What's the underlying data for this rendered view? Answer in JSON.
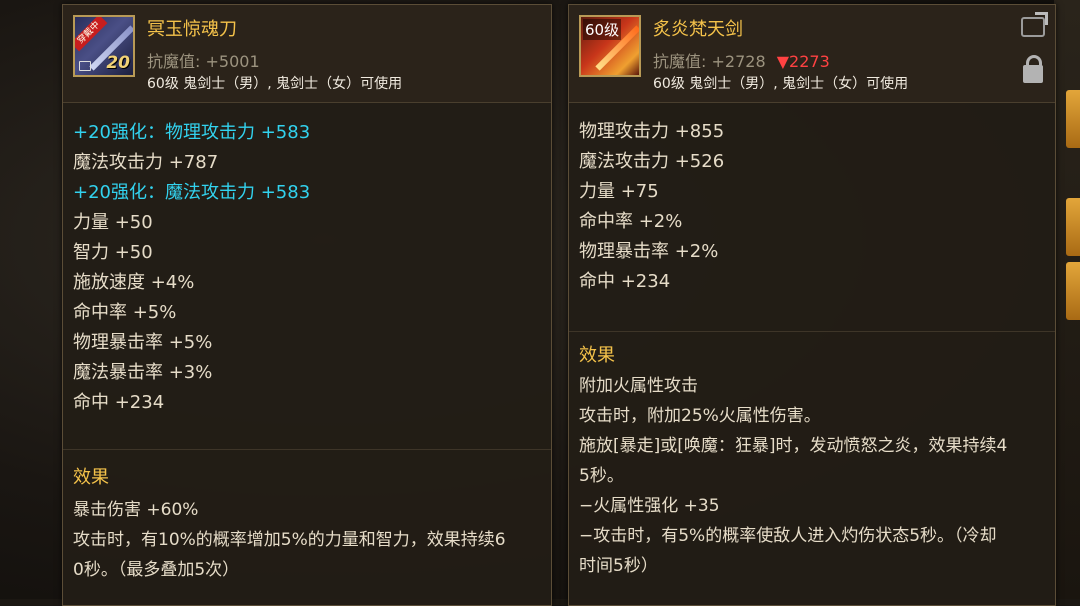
{
  "left_item": {
    "icon": "sword-icon",
    "badge": "穿戴中",
    "enhance_level": "20",
    "name": "冥玉惊魂刀",
    "resist_label": "抗魔值:",
    "resist_value": "+5001",
    "class_req": "60级 鬼剑士（男）, 鬼剑士（女）可使用",
    "stats": [
      {
        "text": "+20强化：物理攻击力 +583",
        "highlight": true
      },
      {
        "text": "魔法攻击力 +787",
        "highlight": false
      },
      {
        "text": "+20强化：魔法攻击力 +583",
        "highlight": true
      },
      {
        "text": "力量 +50",
        "highlight": false
      },
      {
        "text": "智力 +50",
        "highlight": false
      },
      {
        "text": "施放速度 +4%",
        "highlight": false
      },
      {
        "text": "命中率 +5%",
        "highlight": false
      },
      {
        "text": "物理暴击率 +5%",
        "highlight": false
      },
      {
        "text": "魔法暴击率 +3%",
        "highlight": false
      },
      {
        "text": "命中 +234",
        "highlight": false
      }
    ],
    "effect_title": "效果",
    "effect_lines": [
      "暴击伤害 +60%",
      "攻击时，有10%的概率增加5%的力量和智力，效果持续6",
      "0秒。（最多叠加5次）"
    ]
  },
  "right_item": {
    "icon": "flame-sword-icon",
    "level_badge": "60级",
    "name": "炙炎梵天剑",
    "resist_label": "抗魔值:",
    "resist_value": "+2728",
    "resist_diff": "▼2273",
    "class_req": "60级 鬼剑士（男）, 鬼剑士（女）可使用",
    "stats": [
      "物理攻击力 +855",
      "魔法攻击力 +526",
      "力量 +75",
      "命中率 +2%",
      "物理暴击率 +2%",
      "命中 +234"
    ],
    "effect_title": "效果",
    "effect_lines": [
      "附加火属性攻击",
      "攻击时，附加25%火属性伤害。",
      "施放[暴走]或[唤魔：狂暴]时，发动愤怒之炎，效果持续4",
      "5秒。",
      "−火属性强化 +35",
      "−攻击时，有5%的概率使敌人进入灼伤状态5秒。（冷却",
      "时间5秒）"
    ]
  },
  "colors": {
    "title": "#f4c24a",
    "enhance": "#32d2ee",
    "down": "#ff4242"
  }
}
